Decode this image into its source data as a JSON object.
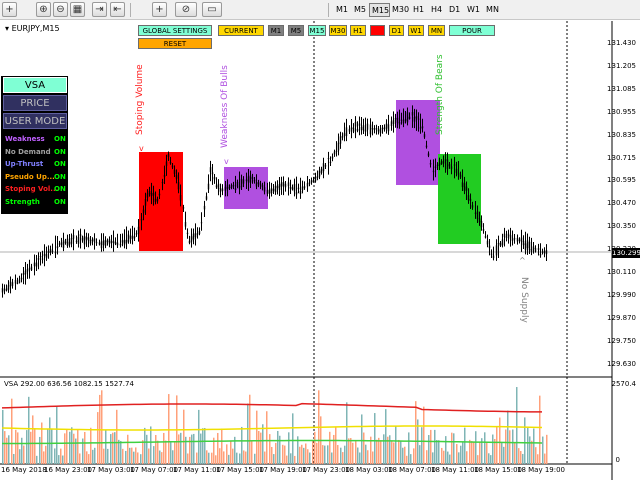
{
  "toolbar": {
    "icons": [
      "crosshair-icon",
      "zoom-in-icon",
      "zoom-out-icon",
      "tile-windows-icon",
      "scroll-chart-icon",
      "chart-shift-icon",
      "indicators-icon",
      "templates-icon"
    ],
    "timeframes": [
      "M1",
      "M5",
      "M15",
      "M30",
      "H1",
      "H4",
      "D1",
      "W1",
      "MN"
    ],
    "active_timeframe": "M15"
  },
  "chart": {
    "symbol": "EURJPY,M15",
    "current_price": "130.299",
    "price_axis": [
      "131.430",
      "131.205",
      "131.085",
      "130.955",
      "130.835",
      "130.715",
      "130.595",
      "130.470",
      "130.350",
      "130.230",
      "130.110",
      "129.990",
      "129.870",
      "129.750",
      "129.630"
    ],
    "time_axis": [
      "16 May 2018",
      "16 May 23:00",
      "17 May 03:00",
      "17 May 07:00",
      "17 May 11:00",
      "17 May 15:00",
      "17 May 19:00",
      "17 May 23:00",
      "18 May 03:00",
      "18 May 07:00",
      "18 May 11:00",
      "18 May 15:00",
      "18 May 19:00"
    ]
  },
  "header_buttons": {
    "global_settings": "GLOBAL SETTINGS",
    "reset": "RESET",
    "current": "CURRENT",
    "timeframes": [
      "M1",
      "M5",
      "M15",
      "M30",
      "H1",
      "D1",
      "W1",
      "MN"
    ],
    "pour": "POUR"
  },
  "panel": {
    "vsa": "VSA",
    "price_action": "PRICE ACTION",
    "user_mode": "USER MODE",
    "signals": [
      {
        "name": "Weakness",
        "value": "ON",
        "color": "#c060ff"
      },
      {
        "name": "No Demand",
        "value": "ON",
        "color": "#a0a0a0"
      },
      {
        "name": "Up-Thrust",
        "value": "ON",
        "color": "#8080ff"
      },
      {
        "name": "Pseudo Up...",
        "value": "ON",
        "color": "#ffa500"
      },
      {
        "name": "Stoping Vol...",
        "value": "ON",
        "color": "#ff2020"
      },
      {
        "name": "Strength",
        "value": "ON",
        "color": "#00ff00"
      }
    ]
  },
  "annotations": {
    "stopping_volume": "Stoping Volume",
    "weakness_of_bulls": "Weakness Of Bulls",
    "strength_of_bears": "Strength Of Bears",
    "no_supply": "No Supply"
  },
  "subwindow": {
    "header": "VSA 292.00 636.56 1082.15 1527.74",
    "axis_top": "2570.4",
    "axis_bottom": "0"
  },
  "colors": {
    "stopping_volume_box": "#ff0000",
    "weakness_box": "#b050e0",
    "strength_box": "#22cc22",
    "vol_up": "#7fb5b5",
    "vol_down": "#ffa07a",
    "ma_red": "#e02020",
    "ma_yellow": "#f0e000",
    "ma_green": "#40d040"
  }
}
